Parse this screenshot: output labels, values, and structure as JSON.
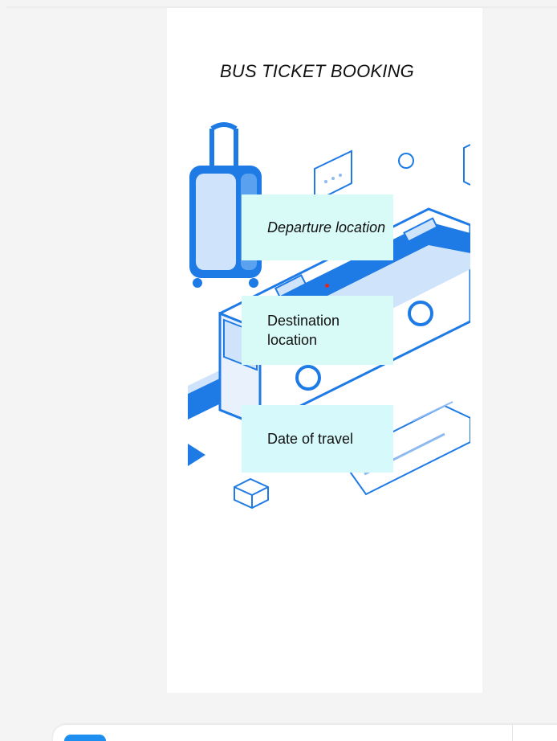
{
  "app": {
    "title": "BUS TICKET BOOKING"
  },
  "form": {
    "departure_label": "Departure location",
    "destination_label": "Destination location",
    "date_label": "Date of travel"
  },
  "colors": {
    "background": "#f4f4f4",
    "field_fill": "#d6fbf6",
    "illustration_blue": "#1e7be6",
    "illustration_light": "#cfe3fb",
    "bottom_tab": "#1e8ef0"
  },
  "icons": {
    "illustration": "bus-travel-illustration",
    "bottom_tab": "app-tab-icon"
  }
}
